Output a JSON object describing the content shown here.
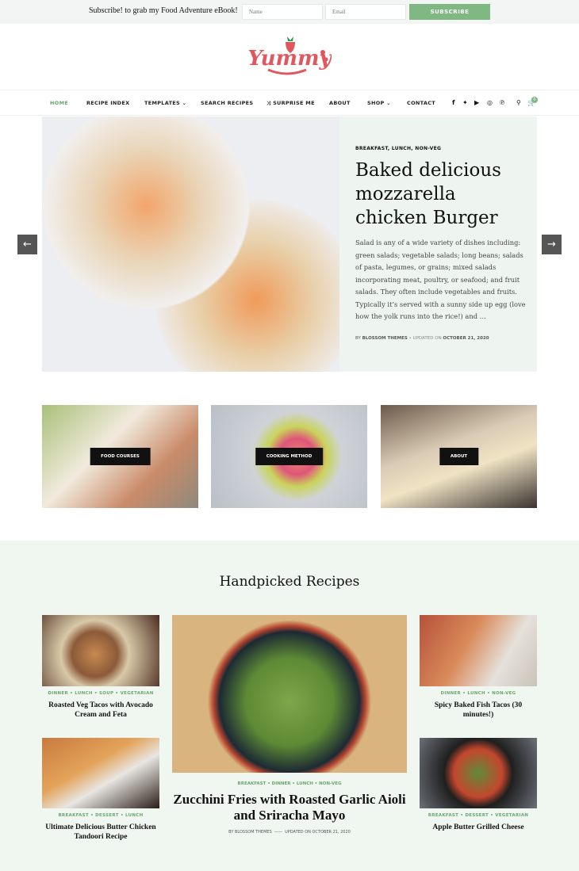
{
  "topbar": {
    "message": "Subscribe! to grab my Food Adventure eBook!",
    "name_placeholder": "Name",
    "email_placeholder": "Email",
    "subscribe": "SUBSCRIBE"
  },
  "logo": {
    "text": "Yummy"
  },
  "nav": {
    "items": [
      "HOME",
      "RECIPE INDEX",
      "TEMPLATES ⌄",
      "SEARCH RECIPES",
      "⤨ SURPRISE ME",
      "ABOUT",
      "SHOP ⌄",
      "CONTACT"
    ],
    "cart_count": "0",
    "active_color": "#6aa66f"
  },
  "hero": {
    "categories": "BREAKFAST, LUNCH, NON-VEG",
    "title": "Baked delicious mozzarella chicken Burger",
    "excerpt": "Salad is any of a wide variety of dishes including: green salads; vegetable salads; long beans; salads of pasta, legumes, or grains; mixed salads incorporating meat, poultry, or seafood; and fruit salads. They often include vegetables and fruits. Typically it’s served with a sunny side up egg (love how the yolk runs into the rice!) and …",
    "by": "BY",
    "author": "BLOSSOM THEMES",
    "updated": "• UPDATED ON",
    "date": "OCTOBER 21, 2020",
    "prev": "←",
    "next": "→"
  },
  "categories": [
    "FOOD COURSES",
    "COOKING METHOD",
    "ABOUT"
  ],
  "handpicked": {
    "title": "Handpicked Recipes",
    "left": [
      {
        "cats": "DINNER • LUNCH • SOUP • VEGETARIAN",
        "title": "Roasted Veg Tacos with Avocado Cream and Feta"
      },
      {
        "cats": "BREAKFAST • DESSERT • LUNCH",
        "title": "Ultimate Delicious Butter Chicken Tandoori Recipe"
      }
    ],
    "center": {
      "cats": "BREAKFAST • DINNER • LUNCH • NON-VEG",
      "title": "Zucchini Fries with Roasted Garlic Aioli and Sriracha Mayo",
      "author": "BY BLOSSOM THEMES",
      "updated": "UPDATED ON OCTOBER 21, 2020"
    },
    "right": [
      {
        "cats": "DINNER • LUNCH • NON-VEG",
        "title": "Spicy Baked Fish Tacos (30 minutes!)"
      },
      {
        "cats": "BREAKFAST • DESSERT • VEGETARIAN",
        "title": "Apple Butter Grilled Cheese"
      }
    ]
  },
  "colors": {
    "accent": "#7fb883",
    "logo": "#e0575e",
    "panel": "#eef4ef"
  }
}
